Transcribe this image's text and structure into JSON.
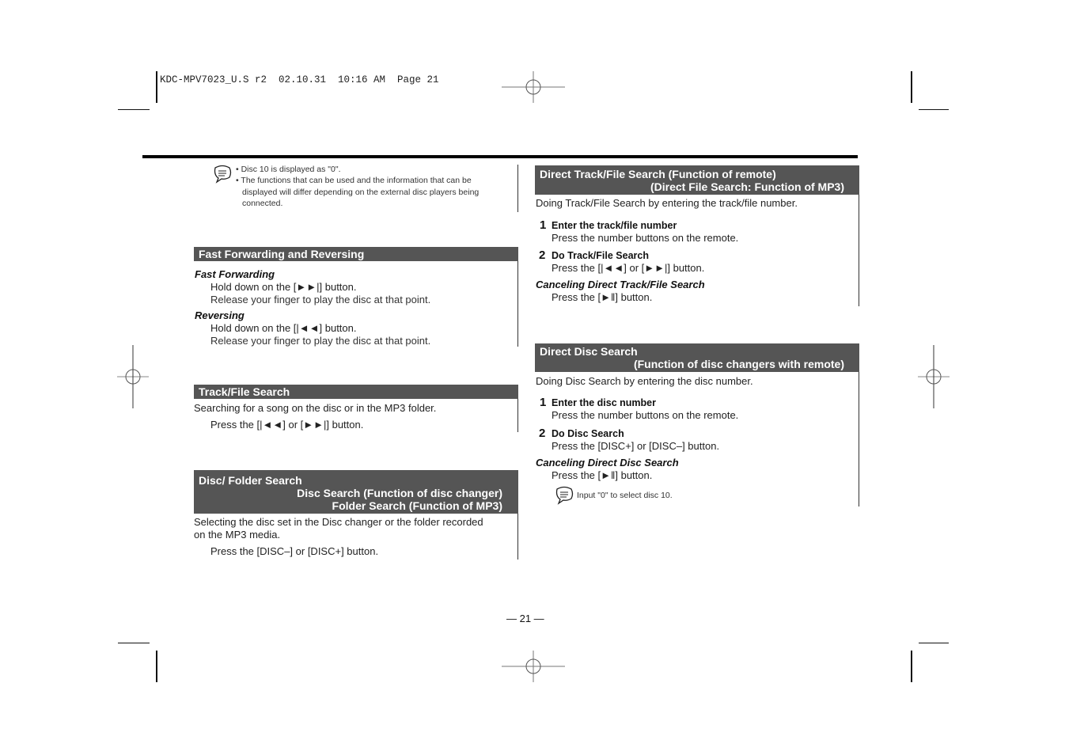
{
  "print_header": "KDC-MPV7023_U.S r2  02.10.31  10:16 AM  Page 21",
  "top_note": {
    "icon": "note-icon",
    "bullets": [
      "Disc 10 is displayed as \"0\".",
      "The functions that can be used and the information that can be",
      "displayed will differ depending on the external disc players being",
      "connected."
    ]
  },
  "sections": {
    "fast_forward": {
      "title": "Fast Forwarding and Reversing",
      "ff_heading": "Fast Forwarding",
      "ff_line1": "Hold down on the [►►|] button.",
      "ff_line2": "Release your finger to play the disc at that point.",
      "rev_heading": "Reversing",
      "rev_line1": "Hold down on the [|◄◄] button.",
      "rev_line2": "Release your finger to play the disc at that point."
    },
    "track_search": {
      "title": "Track/File Search",
      "desc": "Searching for a song on the disc or in the MP3 folder.",
      "instr": "Press the [|◄◄] or [►►|] button."
    },
    "disc_folder": {
      "title_l1": "Disc/ Folder Search",
      "title_l2": "Disc Search (Function of disc changer)",
      "title_l3": "Folder Search (Function of MP3)",
      "desc_l1": "Selecting the disc set in the Disc changer or the folder recorded",
      "desc_l2": "on the MP3 media.",
      "instr": "Press the [DISC–] or [DISC+] button."
    },
    "direct_track": {
      "title_l1": "Direct Track/File Search (Function of remote)",
      "title_l2": "(Direct File Search: Function of MP3)",
      "desc": "Doing Track/File Search by entering the track/file number.",
      "steps": [
        {
          "num": "1",
          "head": "Enter the track/file number",
          "body": "Press the number buttons on the remote."
        },
        {
          "num": "2",
          "head": "Do Track/File Search",
          "body": "Press the [|◄◄] or [►►|] button."
        }
      ],
      "cancel_heading": "Canceling Direct Track/File Search",
      "cancel_body": "Press the [►‖] button."
    },
    "direct_disc": {
      "title_l1": "Direct Disc Search",
      "title_l2": "(Function of disc changers with remote)",
      "desc": "Doing Disc Search by entering the disc number.",
      "steps": [
        {
          "num": "1",
          "head": "Enter the disc number",
          "body": "Press the number buttons on the remote."
        },
        {
          "num": "2",
          "head": "Do Disc Search",
          "body": "Press the [DISC+] or [DISC–] button."
        }
      ],
      "cancel_heading": "Canceling Direct Disc Search",
      "cancel_body": "Press the [►‖] button.",
      "note": "Input \"0\" to select disc 10."
    }
  },
  "page_number": "— 21 —"
}
